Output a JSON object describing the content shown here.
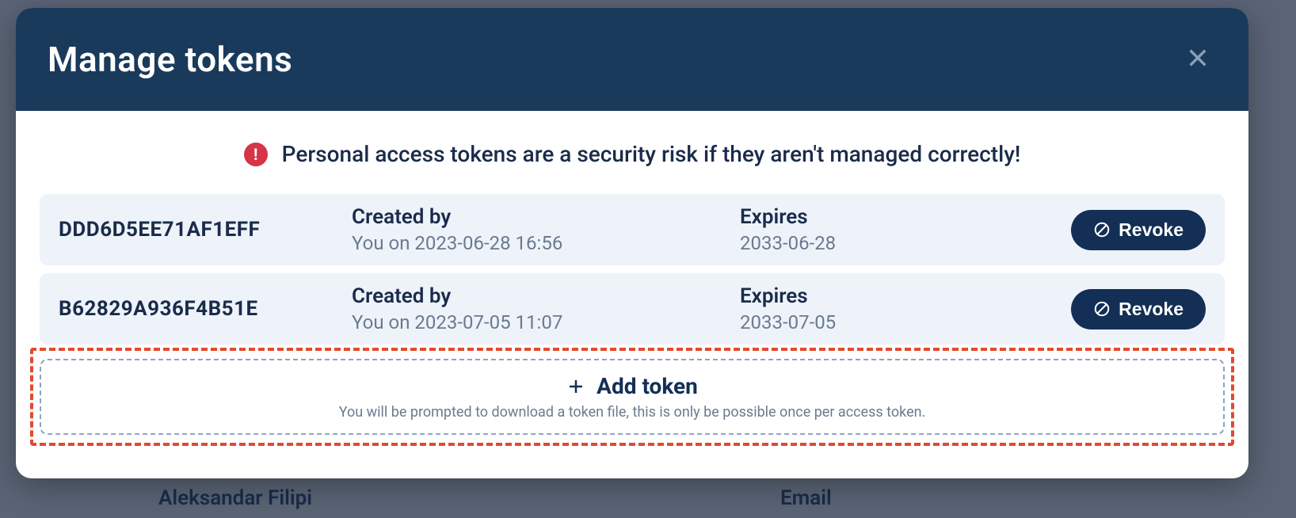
{
  "modal": {
    "title": "Manage tokens",
    "warning": "Personal access tokens are a security risk if they aren't managed correctly!",
    "created_by_label": "Created by",
    "expires_label": "Expires",
    "revoke_label": "Revoke",
    "add_token_label": "Add token",
    "add_token_hint": "You will be prompted to download a token file, this is only be possible once per access token."
  },
  "tokens": [
    {
      "id": "DDD6D5EE71AF1EFF",
      "created_by": "You on 2023-06-28 16:56",
      "expires": "2033-06-28"
    },
    {
      "id": "B62829A936F4B51E",
      "created_by": "You on 2023-07-05 11:07",
      "expires": "2033-07-05"
    }
  ],
  "background": {
    "name_hint": "Aleksandar Filipi",
    "email_hint": "Email"
  }
}
